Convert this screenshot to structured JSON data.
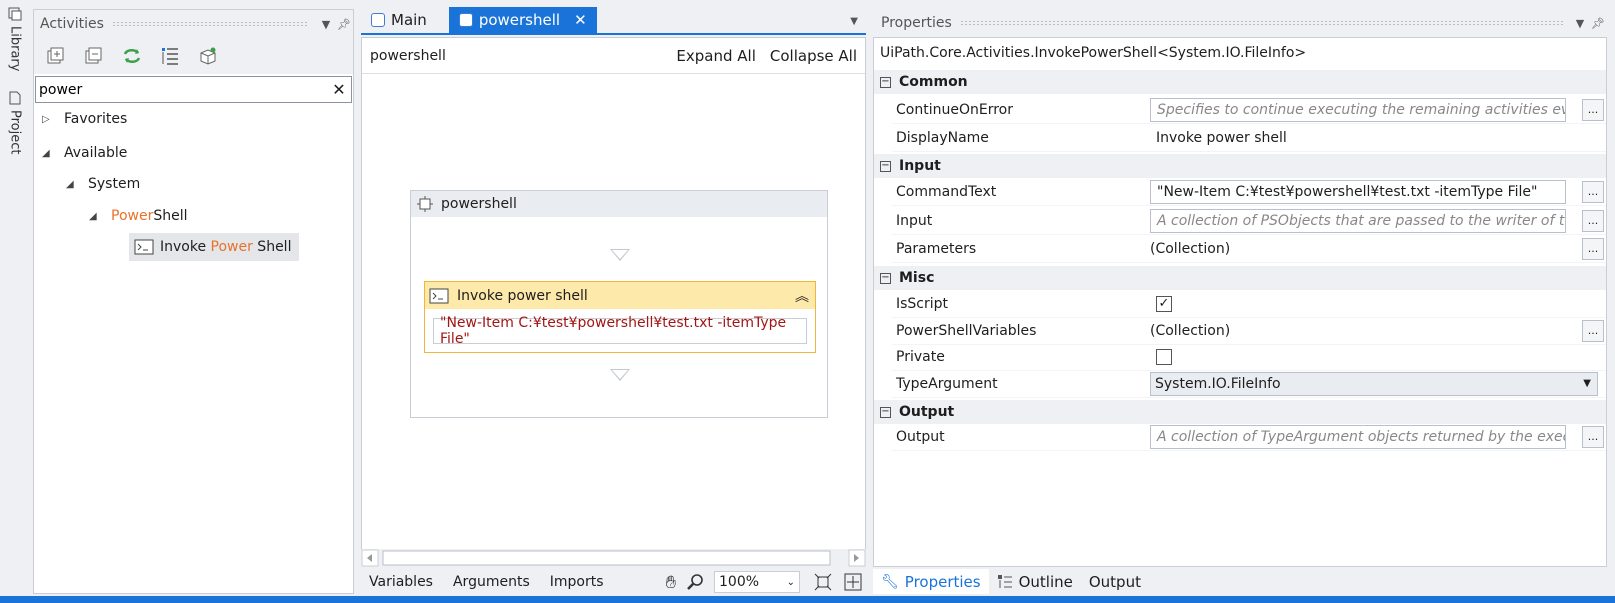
{
  "sidebar": {
    "library": "Library",
    "project": "Project"
  },
  "activities": {
    "title": "Activities",
    "search_value": "power",
    "tree": {
      "favorites": "Favorites",
      "available": "Available",
      "system": "System",
      "powershell_hl": "Power",
      "powershell_rest": "Shell",
      "invoke_pre": "Invoke ",
      "invoke_hl": "Power",
      "invoke_post": " Shell"
    }
  },
  "designer": {
    "tabs": [
      {
        "label": "Main"
      },
      {
        "label": "powershell"
      }
    ],
    "breadcrumb": "powershell",
    "expand_all": "Expand All",
    "collapse_all": "Collapse All",
    "sequence_title": "powershell",
    "activity_title": "Invoke power shell",
    "activity_command": "\"New-Item C:¥test¥powershell¥test.txt -itemType File\"",
    "bottom": {
      "variables": "Variables",
      "arguments": "Arguments",
      "imports": "Imports",
      "zoom": "100%"
    }
  },
  "properties": {
    "title": "Properties",
    "type_name": "UiPath.Core.Activities.InvokePowerShell<System.IO.FileInfo>",
    "categories": {
      "common": "Common",
      "input": "Input",
      "misc": "Misc",
      "output": "Output"
    },
    "rows": {
      "continue_on_error": {
        "name": "ContinueOnError",
        "placeholder": "Specifies to continue executing the remaining activities even i"
      },
      "display_name": {
        "name": "DisplayName",
        "value": "Invoke power shell"
      },
      "command_text": {
        "name": "CommandText",
        "value": "\"New-Item C:¥test¥powershell¥test.txt -itemType File\""
      },
      "input": {
        "name": "Input",
        "placeholder": "A collection of PSObjects that are passed to the writer of the p"
      },
      "parameters": {
        "name": "Parameters",
        "value": "(Collection)"
      },
      "is_script": {
        "name": "IsScript",
        "checked": true
      },
      "ps_variables": {
        "name": "PowerShellVariables",
        "value": "(Collection)"
      },
      "private": {
        "name": "Private",
        "checked": false
      },
      "type_argument": {
        "name": "TypeArgument",
        "value": "System.IO.FileInfo"
      },
      "output": {
        "name": "Output",
        "placeholder": "A collection of TypeArgument objects returned by the executi"
      }
    },
    "bottom_tabs": {
      "properties": "Properties",
      "outline": "Outline",
      "output": "Output"
    }
  },
  "colors": {
    "accent": "#1a73d9",
    "highlight": "#e8722c",
    "activity_header": "#fde9a9",
    "command_text": "#a31515"
  }
}
